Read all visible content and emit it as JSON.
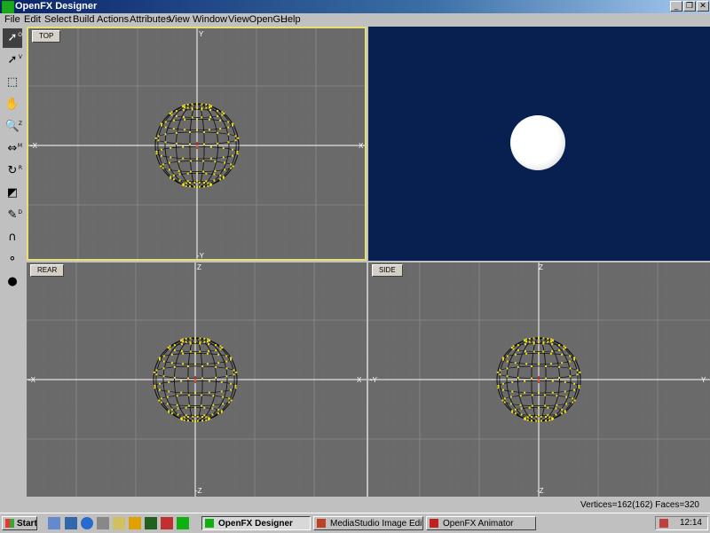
{
  "window": {
    "title": "OpenFX Designer"
  },
  "menu": [
    "File",
    "Edit",
    "Select",
    "Build",
    "Actions",
    "Attributes",
    "View",
    "Window",
    "ViewOpenGL",
    "Help"
  ],
  "toolbar": {
    "keys": [
      "O",
      "V",
      "",
      "",
      "Z",
      "M",
      "R",
      "",
      "D",
      "",
      "",
      ""
    ]
  },
  "viewports": {
    "top": {
      "label": "TOP",
      "axis_top": "Y",
      "axis_bottom": "-Y",
      "axis_left": "-X",
      "axis_right": "X"
    },
    "rear": {
      "label": "REAR",
      "axis_top": "Z",
      "axis_bottom": "-Z",
      "axis_left": "-X",
      "axis_right": "X"
    },
    "side": {
      "label": "SIDE",
      "axis_top": "Z",
      "axis_bottom": "-Z",
      "axis_left": "-Y",
      "axis_right": "Y"
    }
  },
  "status": {
    "text": "Vertices=162(162) Faces=320"
  },
  "taskbar": {
    "start": "Start",
    "buttons": [
      "OpenFX Designer",
      "MediaStudio Image Editor",
      "OpenFX Animator"
    ],
    "clock": "12:14"
  },
  "colors": {
    "accent": "#0a246a",
    "viewport_bg": "#6a6a6a",
    "gl_bg": "#072050",
    "vertex": "#f0e020"
  }
}
